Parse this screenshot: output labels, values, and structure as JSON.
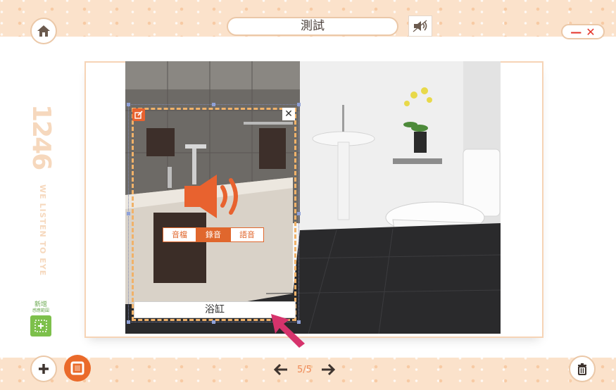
{
  "header": {
    "title": "測試"
  },
  "brand": {
    "number": "1246",
    "tagline": "WE LISTEN TO EYE"
  },
  "add_range": {
    "line1": "新增",
    "line2": "感應範圍"
  },
  "hotspot": {
    "tabs": [
      {
        "label": "音檔",
        "active": false
      },
      {
        "label": "錄音",
        "active": true
      },
      {
        "label": "語音",
        "active": false
      }
    ],
    "caption": "浴缸"
  },
  "pager": {
    "page": "5/5"
  },
  "colors": {
    "accent": "#ea6a2a",
    "bar": "#fbe2cb",
    "close": "#e4342a",
    "dash": "#f0b26a",
    "green": "#7dc04b",
    "pointer": "#d6336c"
  }
}
